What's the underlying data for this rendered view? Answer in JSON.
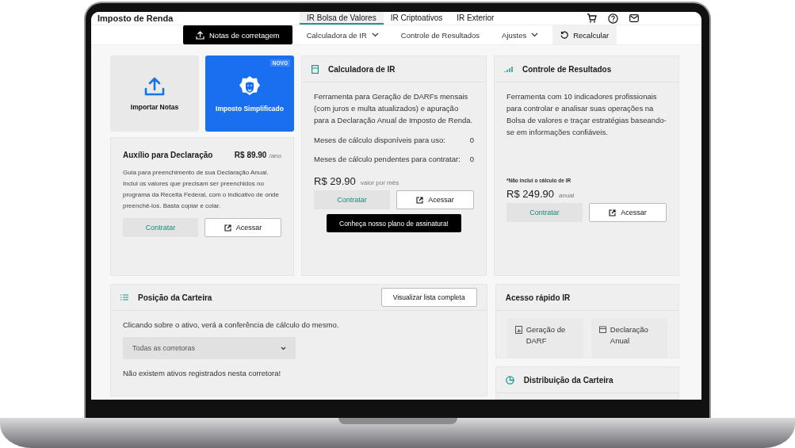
{
  "app_title": "Imposto de Renda",
  "top_tabs": [
    {
      "label": "IR Bolsa de Valores",
      "selected": true
    },
    {
      "label": "IR Criptoativos",
      "selected": false
    },
    {
      "label": "IR Exterior",
      "selected": false
    }
  ],
  "subnav": [
    {
      "kind": "primary",
      "label": "Notas de corretagem"
    },
    {
      "kind": "dropdown",
      "label": "Calculadora de IR"
    },
    {
      "kind": "link",
      "label": "Controle de Resultados"
    },
    {
      "kind": "dropdown",
      "label": "Ajustes"
    },
    {
      "kind": "refresh",
      "label": "Recalcular"
    }
  ],
  "tiles": [
    {
      "kind": "import",
      "label": "Importar Notas"
    },
    {
      "kind": "featured",
      "label": "Imposto Simplificado",
      "badge": "NOVO"
    }
  ],
  "auxilio": {
    "title": "Auxílio para Declaração",
    "price": "R$ 89.90",
    "unit": "/ano",
    "description": "Guia para preenchimento de sua Declaração Anual. Inclui os valores que precisam ser preenchidos no programa da Receita Federal, com o indicativo de onde preenchê-los. Basta copiar e colar.",
    "buttons": [
      "Contratar",
      "Acessar"
    ]
  },
  "calculadora": {
    "title": "Calculadora de IR",
    "description": "Ferramenta para Geração de DARFs mensais (com juros e multa atualizados) e apuração para a Declaração Anual de Imposto de Renda.",
    "stats": [
      {
        "label": "Meses de cálculo disponíveis para uso:",
        "value": "0"
      },
      {
        "label": "Meses de cálculo pendentes para contratar:",
        "value": "0"
      }
    ],
    "price": "R$ 29.90",
    "unit": "valor por mês",
    "buttons": [
      "Contratar",
      "Acessar"
    ],
    "banner": "Conheça nosso plano de assinatura!"
  },
  "controle": {
    "title": "Controle de Resultados",
    "description": "Ferramenta com 10 indicadores profissionais para controlar e analisar suas operações na Bolsa de valores e traçar estratégias baseando-se em informações confiáveis.",
    "note": "*Não inclui o cálculo de IR",
    "price": "R$ 249.90",
    "unit": "anual",
    "buttons": [
      "Contratar",
      "Acessar"
    ]
  },
  "posicao": {
    "title": "Posição da Carteira",
    "button": "Visualizar lista completa",
    "hint": "Clicando sobre o ativo, verá a conferência de cálculo do mesmo.",
    "select": "Todas as corretoras",
    "empty": "Não existem ativos registrados nesta corretora!"
  },
  "acesso": {
    "title": "Acesso rápido IR",
    "items": [
      {
        "kind": "darf",
        "label": "Geração de DARF"
      },
      {
        "kind": "calendar",
        "label": "Declaração Anual"
      }
    ]
  },
  "distribuicao": {
    "title": "Distribuição da Carteira"
  }
}
